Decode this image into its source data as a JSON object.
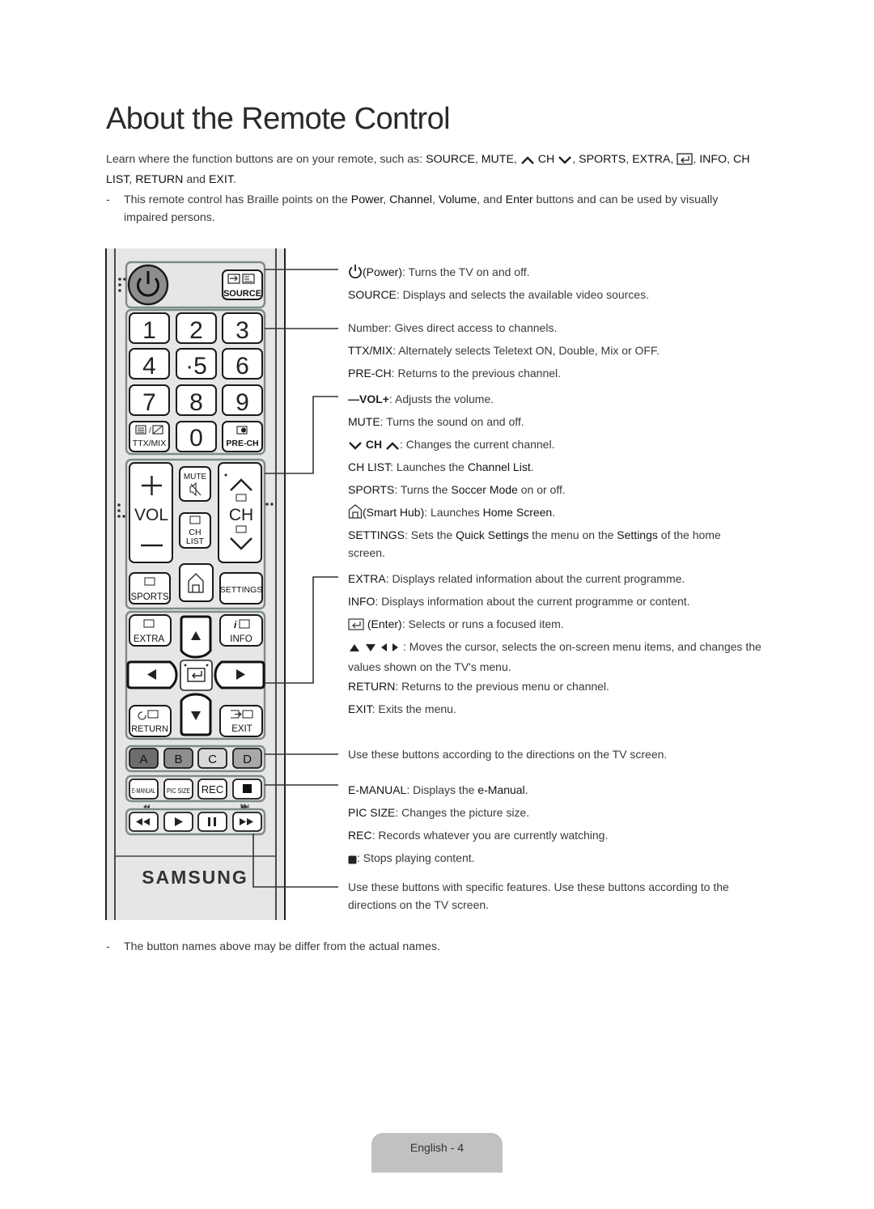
{
  "page": {
    "title": "About the Remote Control",
    "intro": {
      "prefix": "Learn where the function buttons are on your remote, such as: ",
      "source": "SOURCE",
      "sep1": ", ",
      "mute": "MUTE",
      "sep2": ", ",
      "ch": "CH",
      "sep3": ", ",
      "sports": "SPORTS",
      "sep4": ", ",
      "extra": "EXTRA",
      "sep5": ", ",
      "sep6": ", ",
      "info": "INFO",
      "sep7": ", ",
      "chlist": "CH LIST",
      "sep8": ", ",
      "return": "RETURN",
      "and": " and ",
      "exit": "EXIT",
      "end": "."
    },
    "braille_note": {
      "dash": "-",
      "p1": "This remote control has Braille points on the ",
      "power": "Power",
      "c1": ", ",
      "channel": "Channel",
      "c2": ", ",
      "volume": "Volume",
      "c3": ", and ",
      "enter": "Enter",
      "p2": " buttons and can be used by visually impaired persons."
    },
    "bottom_note": {
      "dash": "-",
      "text": "The button names above may be differ from the actual names."
    },
    "footer": {
      "page_label": "English - 4"
    }
  },
  "descriptions": {
    "power": {
      "key": "(Power)",
      "text": ": Turns the TV on and off.",
      "icon": "power-icon"
    },
    "source": {
      "key": "SOURCE",
      "text": ": Displays and selects the available video sources."
    },
    "number": {
      "key": "Number",
      "text": ": Gives direct access to channels."
    },
    "ttx": {
      "key": "TTX/MIX",
      "text": ": Alternately selects Teletext ON, Double, Mix or OFF."
    },
    "prech": {
      "key": "PRE-CH",
      "text": ": Returns to the previous channel."
    },
    "vol": {
      "key": "VOL",
      "text": ": Adjusts the volume."
    },
    "mute": {
      "key": "MUTE",
      "text": ": Turns the sound on and off."
    },
    "ch": {
      "key": "CH",
      "text": ": Changes the current channel."
    },
    "chlist": {
      "key": "CH LIST",
      "text1": ": Launches the ",
      "em": "Channel List",
      "text2": "."
    },
    "sports": {
      "key": "SPORTS",
      "text1": ": Turns the ",
      "em": "Soccer Mode",
      "text2": " on or off."
    },
    "smarthub": {
      "key": "(Smart Hub)",
      "text1": ": Launches ",
      "em": "Home Screen",
      "text2": ".",
      "icon": "home-icon"
    },
    "settings": {
      "key": "SETTINGS",
      "text1": ": Sets the ",
      "em1": "Quick Settings",
      "text2": " the menu on the ",
      "em2": "Settings",
      "text3": " of the home screen."
    },
    "extra": {
      "key": "EXTRA",
      "text": ": Displays related information about the current programme."
    },
    "info": {
      "key": "INFO",
      "text": ": Displays information about the current programme or content."
    },
    "enter": {
      "key": "(Enter)",
      "text": ": Selects or runs a focused item.",
      "icon": "enter-icon"
    },
    "arrows": {
      "text": ": Moves the cursor, selects the on-screen menu items, and changes the values shown on the TV's menu."
    },
    "return": {
      "key": "RETURN",
      "text": ": Returns to the previous menu or channel."
    },
    "exit": {
      "key": "EXIT",
      "text": ": Exits the menu."
    },
    "color_buttons": {
      "text": "Use these buttons according to the directions on the TV screen."
    },
    "emanual": {
      "key": "E-MANUAL",
      "text1": ": Displays the ",
      "em": "e-Manual",
      "text2": "."
    },
    "picsize": {
      "key": "PIC SIZE",
      "text": ": Changes the picture size."
    },
    "rec": {
      "key": "REC",
      "text": ": Records whatever you are currently watching."
    },
    "stop": {
      "text": ": Stops playing content.",
      "icon": "stop-icon"
    },
    "media": {
      "text": "Use these buttons with specific features. Use these buttons according to the directions on the TV screen."
    }
  },
  "remote": {
    "brand": "SAMSUNG",
    "source_label": "SOURCE",
    "digits": [
      "1",
      "2",
      "3",
      "4",
      "·5",
      "6",
      "7",
      "8",
      "9"
    ],
    "ttx_label": "TTX/MIX",
    "zero": "0",
    "prech_label": "PRE-CH",
    "vol_label": "VOL",
    "ch_label": "CH",
    "mute_label": "MUTE",
    "chlist_l1": "CH",
    "chlist_l2": "LIST",
    "sports_label": "SPORTS",
    "settings_label": "SETTINGS",
    "extra_label": "EXTRA",
    "info_label": "INFO",
    "return_label": "RETURN",
    "exit_label": "EXIT",
    "color_keys": [
      {
        "label": "A",
        "color": "#6d6d6d"
      },
      {
        "label": "B",
        "color": "#8e8e8e"
      },
      {
        "label": "C",
        "color": "#d9d9d9"
      },
      {
        "label": "D",
        "color": "#a8a8a8"
      }
    ],
    "func_keys": [
      "E-MANUAL",
      "PIC SIZE",
      "REC"
    ],
    "body_color": "#e6e6e6",
    "group_border": "#7d8b88"
  }
}
